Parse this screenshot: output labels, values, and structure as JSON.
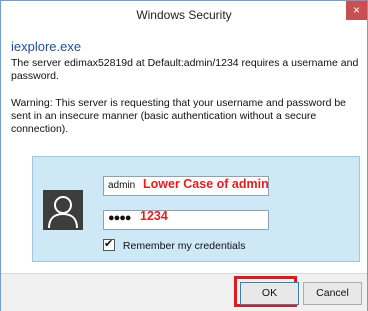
{
  "window": {
    "title": "Windows Security",
    "close_label": "×"
  },
  "dialog": {
    "app_name": "iexplore.exe",
    "message": "The server edimax52819d at Default:admin/1234 requires a username and password.",
    "warning": "Warning: This server is requesting that your username and password be sent in an insecure manner (basic authentication without a secure connection)."
  },
  "credentials": {
    "username_value": "admin",
    "password_masked": "●●●●",
    "remember_label": "Remember my credentials",
    "remember_checked": true,
    "check_glyph": "✔"
  },
  "annotations": {
    "username_note": "Lower Case of admin",
    "password_note": "1234",
    "color": "#e02020"
  },
  "buttons": {
    "ok": "OK",
    "cancel": "Cancel"
  },
  "icons": {
    "avatar": "user-avatar-icon",
    "close": "close-icon",
    "check": "check-icon"
  }
}
